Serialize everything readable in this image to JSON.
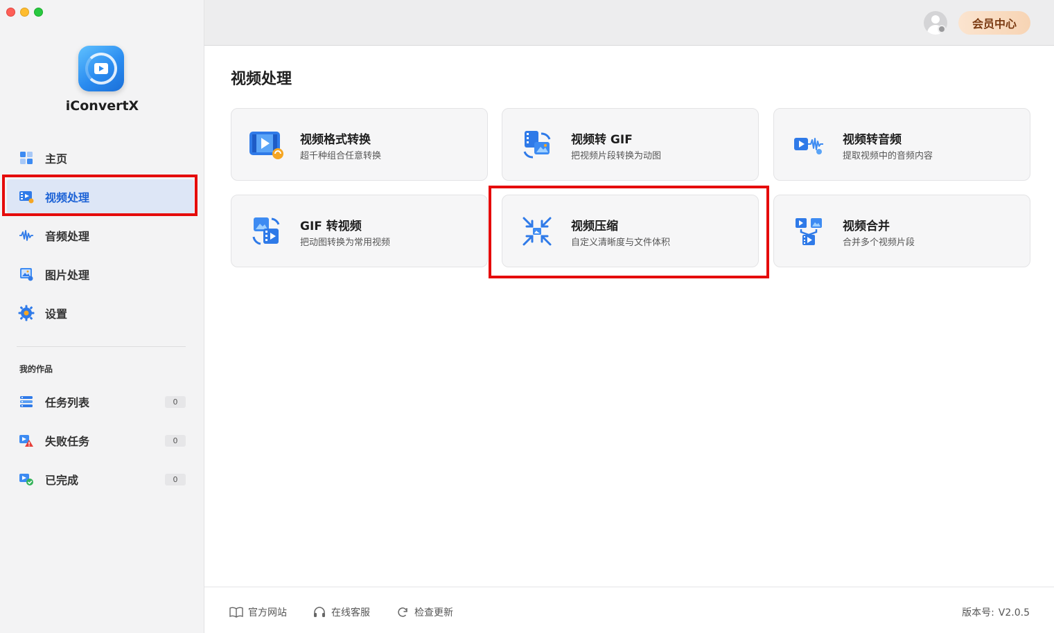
{
  "app": {
    "name": "iConvertX"
  },
  "sidebar": {
    "nav": [
      {
        "id": "home",
        "label": "主页",
        "icon": "home-grid-icon",
        "active": false
      },
      {
        "id": "video",
        "label": "视频处理",
        "icon": "video-processing-icon",
        "active": true
      },
      {
        "id": "audio",
        "label": "音频处理",
        "icon": "audio-wave-icon",
        "active": false
      },
      {
        "id": "image",
        "label": "图片处理",
        "icon": "image-processing-icon",
        "active": false
      },
      {
        "id": "settings",
        "label": "设置",
        "icon": "gear-icon",
        "active": false
      }
    ],
    "section_title": "我的作品",
    "works": [
      {
        "id": "tasks",
        "label": "任务列表",
        "count": "0",
        "icon": "task-list-icon"
      },
      {
        "id": "failed",
        "label": "失败任务",
        "count": "0",
        "icon": "failed-task-icon"
      },
      {
        "id": "done",
        "label": "已完成",
        "count": "0",
        "icon": "completed-icon"
      }
    ]
  },
  "header": {
    "vip_label": "会员中心",
    "avatar_icon": "user-avatar-icon"
  },
  "main": {
    "title": "视频处理",
    "cards": [
      {
        "id": "format",
        "title": "视频格式转换",
        "subtitle": "超千种组合任意转换",
        "icon": "video-format-convert-icon"
      },
      {
        "id": "to-gif",
        "title": "视频转 GIF",
        "subtitle": "把视频片段转换为动图",
        "icon": "video-to-gif-icon"
      },
      {
        "id": "to-audio",
        "title": "视频转音频",
        "subtitle": "提取视频中的音频内容",
        "icon": "video-to-audio-icon"
      },
      {
        "id": "gif-to-video",
        "title": "GIF 转视频",
        "subtitle": "把动图转换为常用视频",
        "icon": "gif-to-video-icon"
      },
      {
        "id": "compress",
        "title": "视频压缩",
        "subtitle": "自定义清晰度与文件体积",
        "icon": "video-compress-icon"
      },
      {
        "id": "merge",
        "title": "视频合并",
        "subtitle": "合并多个视频片段",
        "icon": "video-merge-icon"
      }
    ]
  },
  "footer": {
    "links": [
      {
        "label": "官方网站",
        "icon": "book-icon"
      },
      {
        "label": "在线客服",
        "icon": "headset-icon"
      },
      {
        "label": "检查更新",
        "icon": "refresh-icon"
      }
    ],
    "version_label": "版本号:",
    "version_value": "V2.0.5"
  },
  "colors": {
    "accent": "#1d63d6",
    "annotation": "#e50b0b",
    "vip": "#7a3a12"
  }
}
